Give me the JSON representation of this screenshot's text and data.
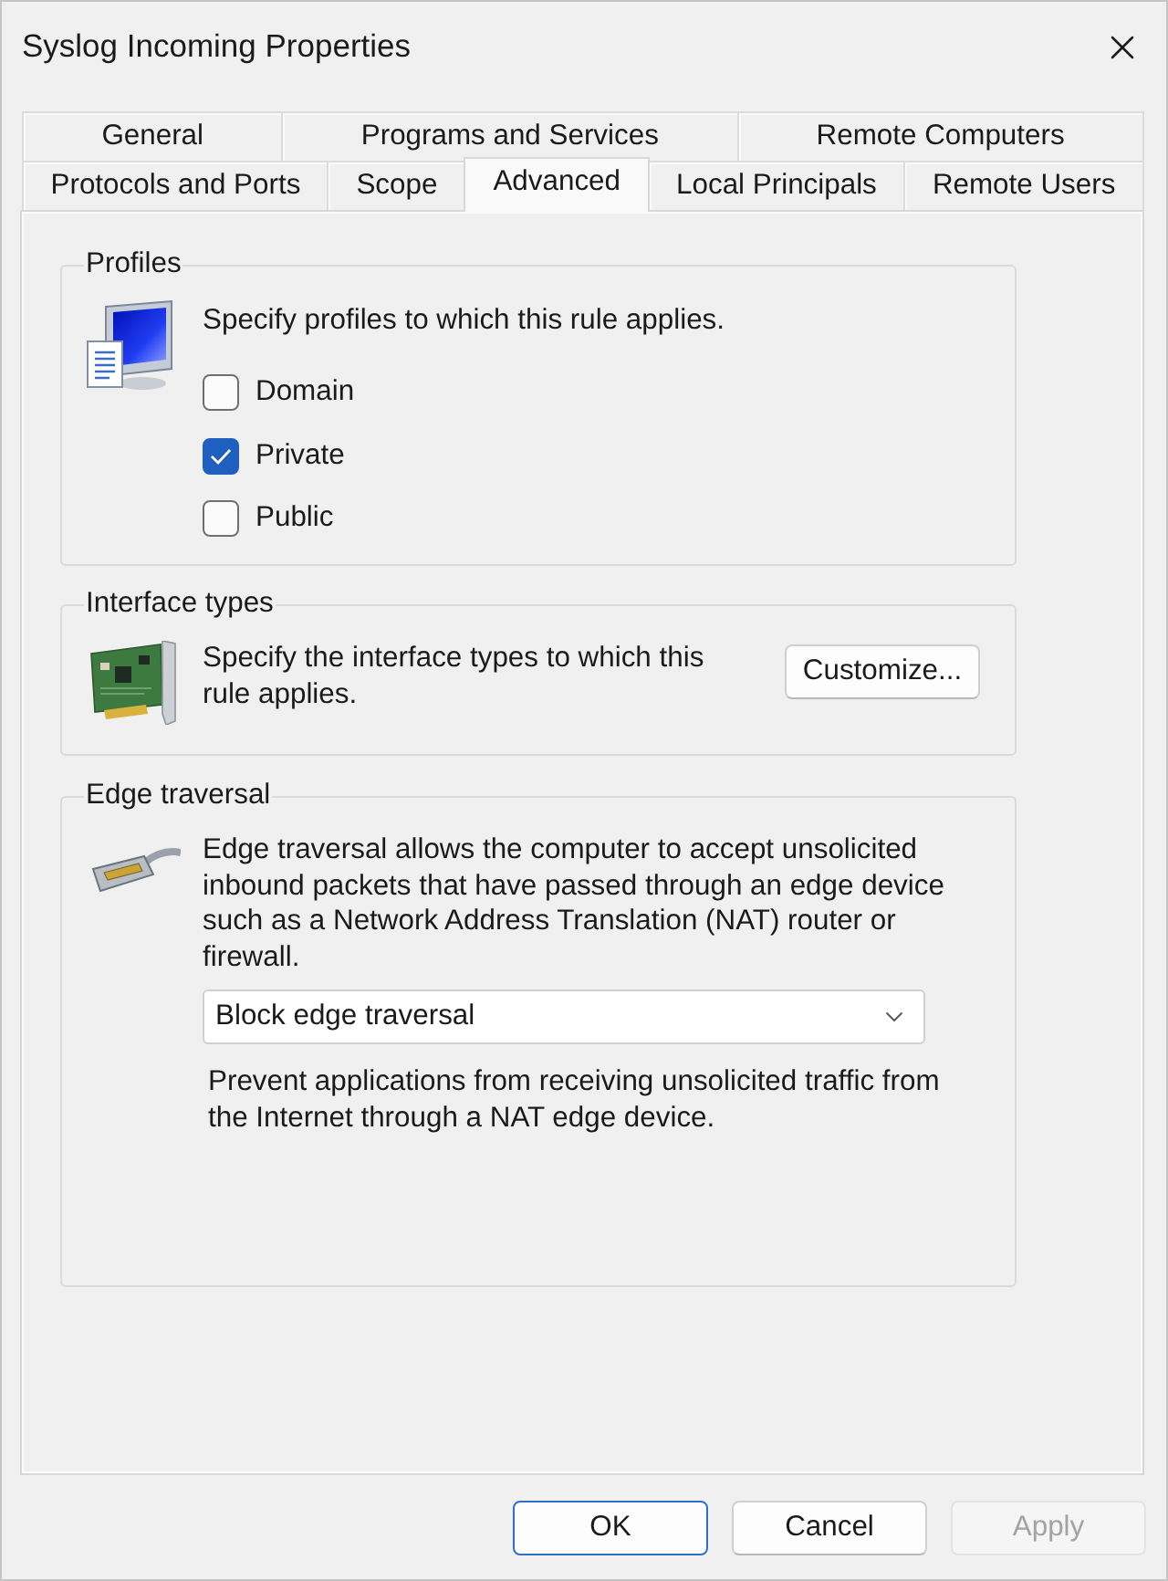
{
  "window": {
    "title": "Syslog Incoming Properties"
  },
  "tab_rows": [
    {
      "tabs": [
        {
          "label": "General",
          "selected": false
        },
        {
          "label": "Programs and Services",
          "selected": false
        },
        {
          "label": "Remote Computers",
          "selected": false
        }
      ]
    },
    {
      "tabs": [
        {
          "label": "Protocols and Ports",
          "selected": false
        },
        {
          "label": "Scope",
          "selected": false
        },
        {
          "label": "Advanced",
          "selected": true
        },
        {
          "label": "Local Principals",
          "selected": false
        },
        {
          "label": "Remote Users",
          "selected": false
        }
      ]
    }
  ],
  "profiles": {
    "title": "Profiles",
    "description": "Specify profiles to which this rule applies.",
    "options": [
      {
        "label": "Domain",
        "checked": false
      },
      {
        "label": "Private",
        "checked": true
      },
      {
        "label": "Public",
        "checked": false
      }
    ]
  },
  "interface_types": {
    "title": "Interface types",
    "description": "Specify the interface types to which this rule applies.",
    "button": "Customize..."
  },
  "edge_traversal": {
    "title": "Edge traversal",
    "description": "Edge traversal allows the computer to accept unsolicited inbound packets that have passed through an edge device such as a Network Address Translation (NAT) router or firewall.",
    "dropdown": {
      "value": "Block edge traversal"
    },
    "note": "Prevent applications from receiving unsolicited traffic from the Internet through a NAT edge device."
  },
  "buttons": [
    {
      "label": "OK",
      "default": true,
      "disabled": false
    },
    {
      "label": "Cancel",
      "default": false,
      "disabled": false
    },
    {
      "label": "Apply",
      "default": false,
      "disabled": true
    }
  ]
}
